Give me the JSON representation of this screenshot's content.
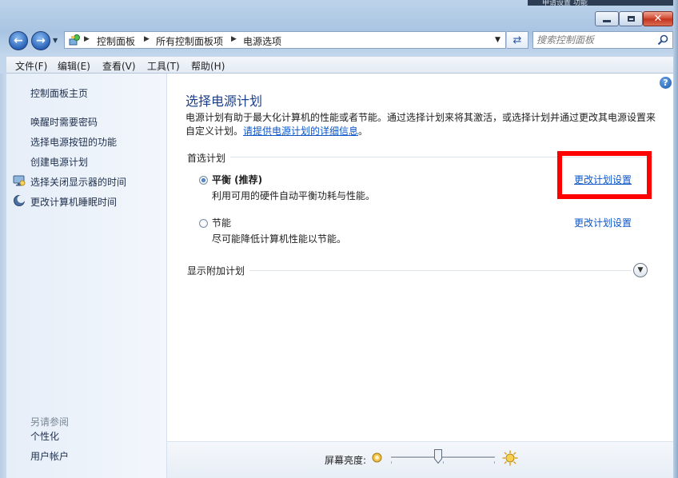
{
  "window": {
    "topstrip_text": "申请设置  功能",
    "caption": {
      "min": "minimize",
      "max": "maximize",
      "close": "✕"
    }
  },
  "address": {
    "crumbs": [
      "控制面板",
      "所有控制面板项",
      "电源选项"
    ],
    "search_placeholder": "搜索控制面板"
  },
  "menu": [
    "文件(F)",
    "编辑(E)",
    "查看(V)",
    "工具(T)",
    "帮助(H)"
  ],
  "sidebar": {
    "home": "控制面板主页",
    "links": [
      {
        "label": "唤醒时需要密码",
        "icon": ""
      },
      {
        "label": "选择电源按钮的功能",
        "icon": ""
      },
      {
        "label": "创建电源计划",
        "icon": ""
      },
      {
        "label": "选择关闭显示器的时间",
        "icon": "monitor-icon"
      },
      {
        "label": "更改计算机睡眠时间",
        "icon": "moon-icon"
      }
    ],
    "see_also_title": "另请参阅",
    "see_also": [
      "个性化",
      "用户帐户"
    ]
  },
  "content": {
    "help": "?",
    "title": "选择电源计划",
    "description": "电源计划有助于最大化计算机的性能或者节能。通过选择计划来将其激活，或选择计划并通过更改其电源设置来自定义计划。",
    "description_link": "请提供电源计划的详细信息",
    "description_end": "。",
    "preferred_section": "首选计划",
    "plans": [
      {
        "name": "平衡 (推荐)",
        "desc": "利用可用的硬件自动平衡功耗与性能。",
        "link": "更改计划设置",
        "selected": true
      },
      {
        "name": "节能",
        "desc": "尽可能降低计算机性能以节能。",
        "link": "更改计划设置",
        "selected": false
      }
    ],
    "more_section": "显示附加计划"
  },
  "brightness": {
    "label": "屏幕亮度:",
    "value": 0.45
  },
  "colors": {
    "highlight": "#ff0000",
    "link": "#0d56c9",
    "title": "#1b3f8b"
  }
}
